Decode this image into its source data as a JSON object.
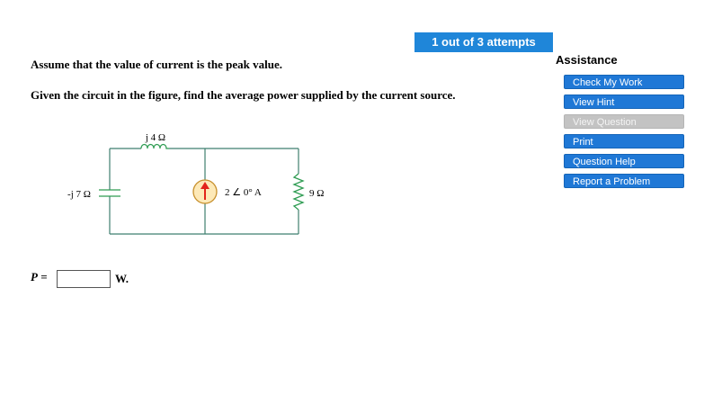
{
  "attempts": "1 out of 3 attempts",
  "question": {
    "line1": "Assume that the value of current is the peak value.",
    "line2": "Given the circuit in the figure, find the average power supplied by the current source."
  },
  "assistance": {
    "title": "Assistance",
    "buttons": [
      {
        "label": "Check My Work",
        "enabled": true
      },
      {
        "label": "View Hint",
        "enabled": true
      },
      {
        "label": "View Question",
        "enabled": false
      },
      {
        "label": "Print",
        "enabled": true
      },
      {
        "label": "Question Help",
        "enabled": true
      },
      {
        "label": "Report a Problem",
        "enabled": true
      }
    ]
  },
  "circuit": {
    "inductor_label": "j 4 Ω",
    "capacitor_label": "-j 7 Ω",
    "source_label": "2 ∠ 0° A",
    "resistor_label": "9 Ω",
    "wire_color": "#3f7f6f",
    "component_color": "#2e9c52",
    "source_fill": "#fde9b8",
    "arrow_color": "#e2231a"
  },
  "answer": {
    "variable": "P",
    "equals": "=",
    "value": "",
    "units": "W."
  }
}
